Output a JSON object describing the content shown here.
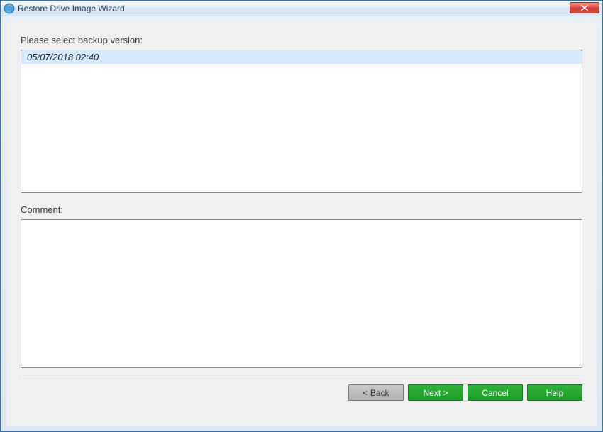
{
  "window": {
    "title": "Restore Drive Image Wizard"
  },
  "labels": {
    "select_version": "Please select backup version:",
    "comment": "Comment:"
  },
  "versions": [
    {
      "label": "05/07/2018 02:40",
      "selected": true
    }
  ],
  "comment_value": "",
  "buttons": {
    "back": "< Back",
    "next": "Next >",
    "cancel": "Cancel",
    "help": "Help"
  }
}
